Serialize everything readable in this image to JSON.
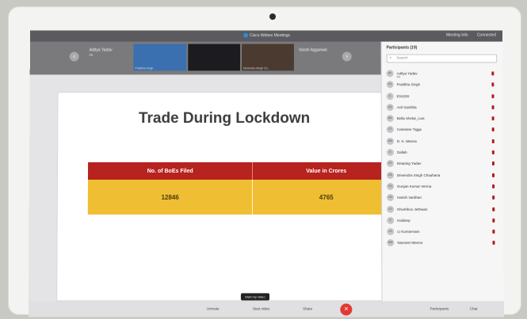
{
  "window": {
    "app_title": "Cisco Webex Meetings",
    "meeting_info": "Meeting Info",
    "connected": "Connected"
  },
  "video_strip": {
    "left_name": "Aditya Yadav",
    "left_sub": "me",
    "tiles": [
      "Pratibha Singh",
      "",
      "Devendra Singh Ch..."
    ],
    "right_name": "Vansh Aggarwal"
  },
  "slide": {
    "title": "Trade During Lockdown",
    "table": {
      "headers": [
        "No. of BoEs Filed",
        "Value in Crores"
      ],
      "values": [
        "12846",
        "4765"
      ]
    }
  },
  "participants": {
    "header": "Participants (19)",
    "search_placeholder": "Search",
    "list": [
      {
        "initials": "AY",
        "name": "Aditya Yadav",
        "sub": "Me"
      },
      {
        "initials": "PS",
        "name": "Pratibha Singh",
        "sub": ""
      },
      {
        "initials": "E",
        "name": "E04209",
        "sub": ""
      },
      {
        "initials": "AS",
        "name": "Anil Sankhla",
        "sub": ""
      },
      {
        "initials": "BS",
        "name": "Bella Shelat_cust",
        "sub": ""
      },
      {
        "initials": "CT",
        "name": "Celestine Tigga",
        "sub": ""
      },
      {
        "initials": "DW",
        "name": "D. K. Meena",
        "sub": ""
      },
      {
        "initials": "D",
        "name": "Dallah",
        "sub": ""
      },
      {
        "initials": "DY",
        "name": "Deeping Yadav",
        "sub": ""
      },
      {
        "initials": "DS",
        "name": "Devendra Singh Chauhana",
        "sub": ""
      },
      {
        "initials": "GV",
        "name": "Gunjan Kumar Verma",
        "sub": ""
      },
      {
        "initials": "HV",
        "name": "Harish Vardhan",
        "sub": ""
      },
      {
        "initials": "KJ",
        "name": "Khushboo Jethwan",
        "sub": ""
      },
      {
        "initials": "K",
        "name": "Kuldeep",
        "sub": ""
      },
      {
        "initials": "LK",
        "name": "Lt Kumarmani",
        "sub": ""
      },
      {
        "initials": "NM",
        "name": "Navneet Meena",
        "sub": ""
      }
    ]
  },
  "footer": {
    "unmute": "Unmute",
    "start_video": "Start video",
    "share": "Share",
    "participants_btn": "Participants",
    "chat_btn": "Chat",
    "tooltip": "Start my video",
    "end_symbol": "✕"
  },
  "colors": {
    "table_header": "#b7231e",
    "table_body": "#f0be32",
    "end_button": "#e23a32"
  }
}
